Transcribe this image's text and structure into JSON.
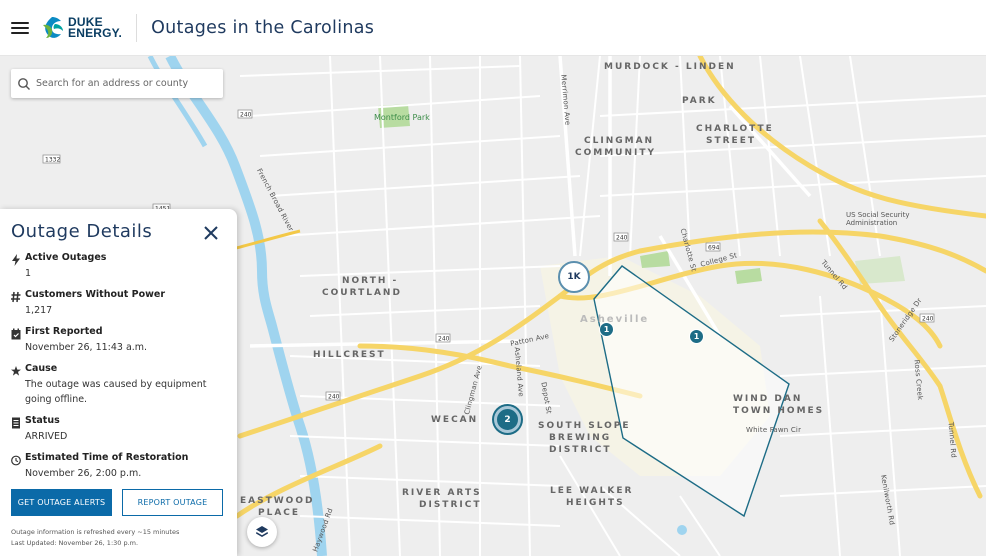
{
  "header": {
    "menu_icon": "hamburger-menu-icon",
    "logo_line1": "DUKE",
    "logo_line2": "ENERGY.",
    "title": "Outages in the Carolinas"
  },
  "search": {
    "placeholder": "Search for an address or county",
    "icon": "search-icon"
  },
  "map": {
    "neighborhoods": [
      "MURDOCK - LINDEN",
      "PARK",
      "CLINGMAN",
      "COMMUNITY",
      "CHARLOTTE",
      "STREET",
      "NORTH -",
      "COURTLAND",
      "HILLCREST",
      "WECAN",
      "SOUTH SLOPE",
      "BREWING",
      "DISTRICT",
      "LEE WALKER",
      "HEIGHTS",
      "RIVER ARTS",
      "DISTRICT",
      "EASTWOOD",
      "PLACE",
      "WIND DAN",
      "TOWN HOMES",
      "Asheville"
    ],
    "parks": [
      "Montford Park",
      "US Social Security Administration"
    ],
    "streets": [
      "Patton Ave",
      "College St",
      "Tunnel Rd",
      "French Broad River",
      "Charlotte St",
      "Clingman Ave",
      "Depot St",
      "Ross Creek",
      "Tunnel Rd",
      "Stoneridge Dr",
      "Kenilworth Rd",
      "White Fawn Cir",
      "Haywood Rd",
      "Merrimon Ave",
      "Asheland Ave"
    ],
    "route_shields": [
      "240",
      "240",
      "240",
      "240",
      "240",
      "694",
      "1332",
      "1451"
    ],
    "clusters": [
      {
        "label": "1K",
        "kind": "outline"
      },
      {
        "label": "2",
        "kind": "filled"
      }
    ],
    "markers": [
      "1",
      "1"
    ],
    "layers_icon": "layers-icon",
    "colors": {
      "water": "#9fd4ef",
      "highway": "#f6d567",
      "outage_outline": "#1d6c86",
      "park": "#b8dca1"
    }
  },
  "panel": {
    "title": "Outage Details",
    "close_icon": "close-icon",
    "details": [
      {
        "icon": "lightning-icon",
        "label": "Active Outages",
        "value": "1"
      },
      {
        "icon": "hash-icon",
        "label": "Customers Without Power",
        "value": "1,217"
      },
      {
        "icon": "calendar-icon",
        "label": "First Reported",
        "value": "November 26, 11:43 a.m."
      },
      {
        "icon": "star-icon",
        "label": "Cause",
        "value": "The outage was caused by equipment going offline."
      },
      {
        "icon": "document-icon",
        "label": "Status",
        "value": "ARRIVED"
      },
      {
        "icon": "clock-icon",
        "label": "Estimated Time of Restoration",
        "value": "November 26, 2:00 p.m."
      }
    ],
    "primary_button": "GET OUTAGE ALERTS",
    "secondary_button": "REPORT OUTAGE",
    "refresh_note": "Outage information is refreshed every ~15 minutes",
    "last_updated": "Last Updated: November 26, 1:30 p.m."
  }
}
